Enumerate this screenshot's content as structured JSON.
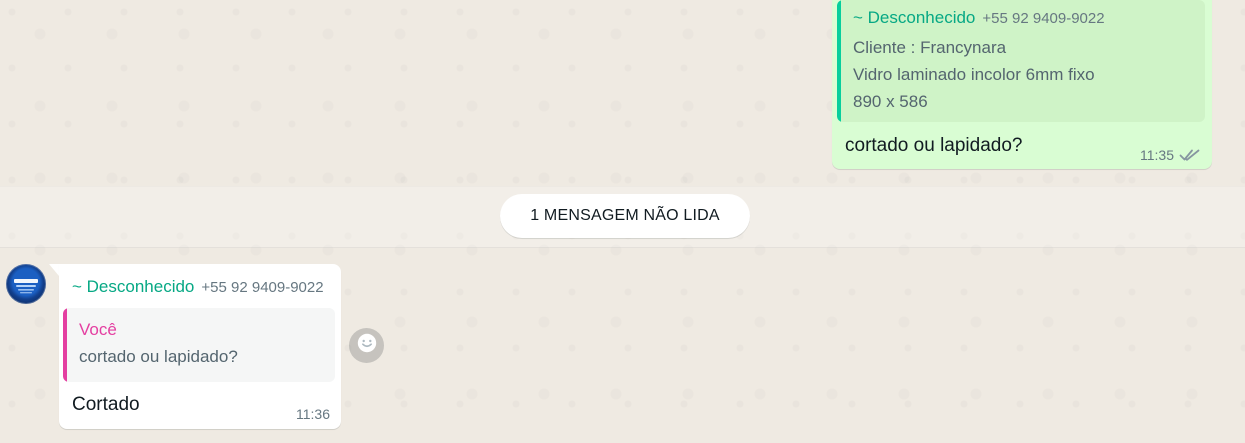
{
  "outgoing_message": {
    "quoted_message": {
      "sender_name": "~ Desconhecido",
      "sender_phone": "+55 92 9409-9022",
      "lines": [
        "Cliente : Francynara",
        "Vidro laminado incolor 6mm fixo",
        "890 x 586"
      ]
    },
    "text": "cortado ou lapidado?",
    "time": "11:35",
    "status_icon": "double-check-icon"
  },
  "unread_banner": {
    "label": "1 MENSAGEM NÃO LIDA"
  },
  "incoming_message": {
    "avatar_icon": "contact-avatar",
    "sender_name": "~ Desconhecido",
    "sender_phone": "+55 92 9409-9022",
    "quoted_message": {
      "author": "Você",
      "text": "cortado ou lapidado?"
    },
    "text": "Cortado",
    "time": "11:36"
  },
  "reaction_button": {
    "icon": "emoji-icon"
  },
  "colors": {
    "chat_background": "#efeae2",
    "outgoing_bubble": "#d9fdd3",
    "incoming_bubble": "#ffffff",
    "sender_accent": "#06a884",
    "you_accent": "#e43fa1",
    "meta_text": "#667781"
  }
}
